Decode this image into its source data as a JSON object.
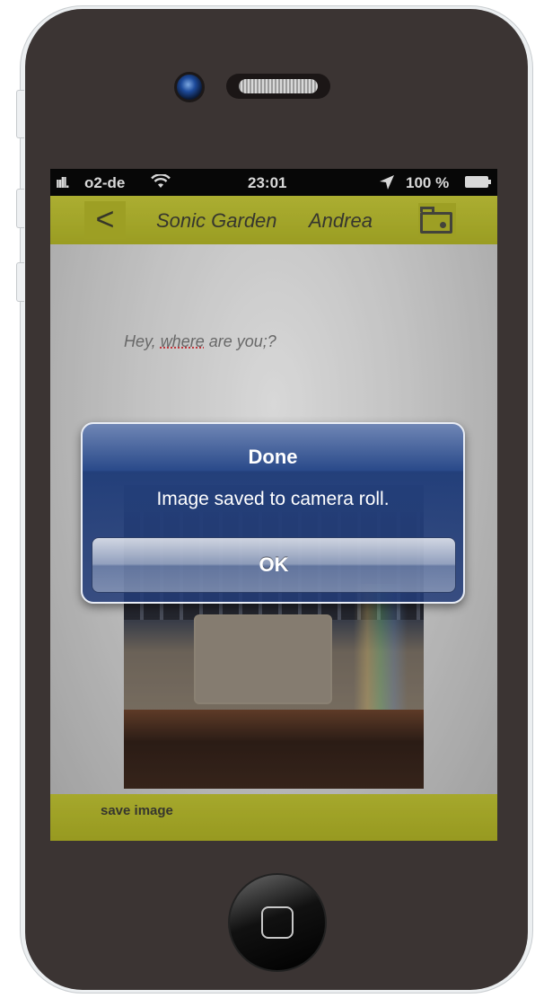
{
  "status_bar": {
    "signal": "ııll.",
    "carrier": "o2-de",
    "wifi_icon": "wifi-icon",
    "time": "23:01",
    "location_icon": "➤",
    "battery_percent": "100 %"
  },
  "nav_bar": {
    "back_label": "<",
    "title": "Sonic Garden",
    "user": "Andrea",
    "folder_icon": "folder-icon"
  },
  "chat": {
    "message_pre": "Hey, ",
    "message_misspelled": "where",
    "message_post": " are you;?"
  },
  "bottom_bar": {
    "save_label": "save image"
  },
  "alert": {
    "title": "Done",
    "message": "Image saved to camera roll.",
    "ok_label": "OK"
  },
  "colors": {
    "accent_bar": "#b4b722",
    "alert_blue": "#233f7a",
    "phone_body": "#3b3433"
  }
}
